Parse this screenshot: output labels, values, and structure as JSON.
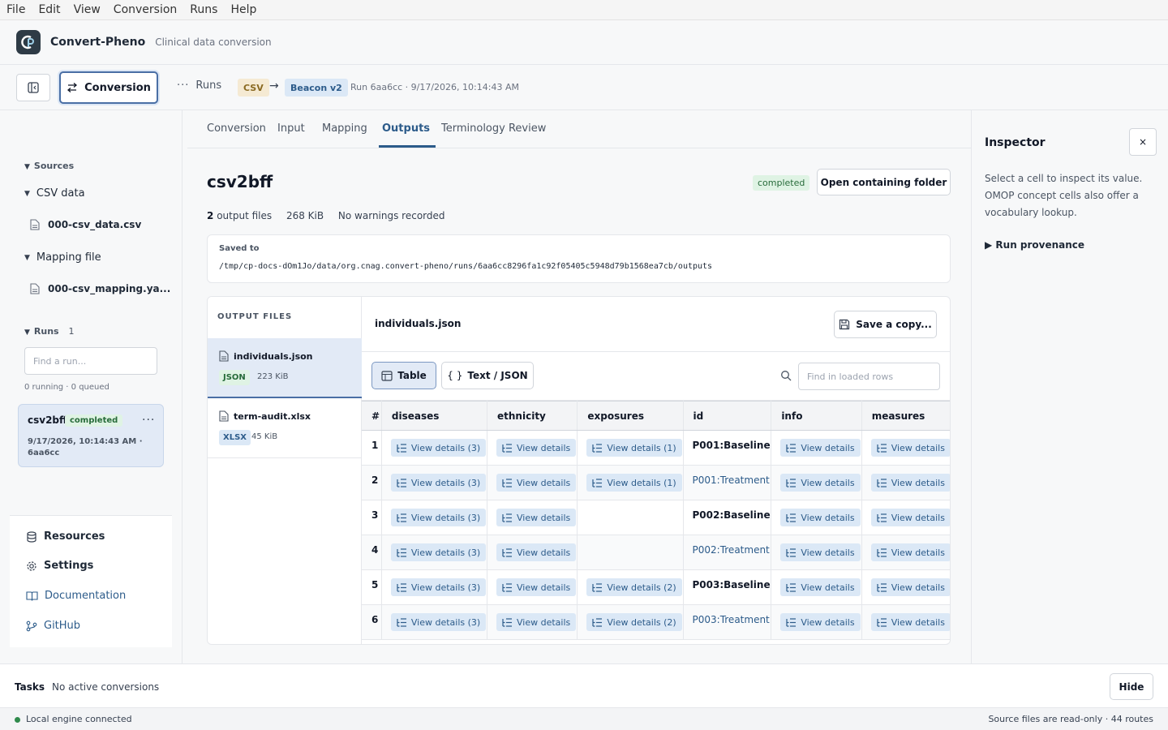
{
  "menu": [
    "File",
    "Edit",
    "View",
    "Conversion",
    "Runs",
    "Help"
  ],
  "app": {
    "name": "Convert-Pheno",
    "subtitle": "Clinical data conversion"
  },
  "toolbar": {
    "conversion_label": "Conversion",
    "runs_label": "Runs",
    "from_format": "CSV",
    "arrow": "→",
    "to_format": "Beacon v2",
    "run_info": "Run 6aa6cc · 9/17/2026, 10:14:43 AM"
  },
  "sidebar": {
    "sources_label": "Sources",
    "csv_group": "CSV data",
    "csv_file": "000-csv_data.csv",
    "mapping_group": "Mapping file",
    "mapping_file": "000-csv_mapping.ya...",
    "runs_label": "Runs",
    "runs_count": "1",
    "run_search_placeholder": "Find a run...",
    "run_status_counts": "0 running · 0 queued",
    "run_card": {
      "name": "csv2bff",
      "status": "completed",
      "more": "···",
      "date": "9/17/2026, 10:14:43 AM · 6aa6cc"
    },
    "nav": {
      "resources": "Resources",
      "settings": "Settings",
      "documentation": "Documentation",
      "github": "GitHub"
    }
  },
  "tabs": [
    "Conversion",
    "Input",
    "Mapping",
    "Outputs",
    "Terminology Review"
  ],
  "active_tab": "Outputs",
  "output": {
    "title": "csv2bff",
    "status": "completed",
    "open_folder": "Open containing folder",
    "file_count": "2",
    "file_count_label": "output files",
    "total_size": "268 KiB",
    "warnings": "No warnings recorded",
    "saved_to_label": "Saved to",
    "saved_path": "/tmp/cp-docs-dOm1Jo/data/org.cnag.convert-pheno/runs/6aa6cc8296fa1c92f05405c5948d79b1568ea7cb/outputs"
  },
  "files_panel": {
    "header": "OUTPUT FILES",
    "files": [
      {
        "name": "individuals.json",
        "type": "JSON",
        "size": "223 KiB"
      },
      {
        "name": "term-audit.xlsx",
        "type": "XLSX",
        "size": "45 KiB"
      }
    ]
  },
  "viewer": {
    "file_title": "individuals.json",
    "save_copy": "Save a copy...",
    "mode_table": "Table",
    "mode_text": "Text / JSON",
    "find_placeholder": "Find in loaded rows",
    "columns": [
      "#",
      "diseases",
      "ethnicity",
      "exposures",
      "id",
      "info",
      "measures"
    ],
    "rows": [
      {
        "num": "1",
        "diseases": "View details (3)",
        "ethnicity": "View details",
        "exposures": "View details (1)",
        "id": "P001:Baseline",
        "info": "View details",
        "measures": "View details"
      },
      {
        "num": "2",
        "diseases": "View details (3)",
        "ethnicity": "View details",
        "exposures": "View details (1)",
        "id": "P001:Treatment",
        "info": "View details",
        "measures": "View details"
      },
      {
        "num": "3",
        "diseases": "View details (3)",
        "ethnicity": "View details",
        "exposures": "",
        "id": "P002:Baseline",
        "info": "View details",
        "measures": "View details"
      },
      {
        "num": "4",
        "diseases": "View details (3)",
        "ethnicity": "View details",
        "exposures": "",
        "id": "P002:Treatment",
        "info": "View details",
        "measures": "View details"
      },
      {
        "num": "5",
        "diseases": "View details (3)",
        "ethnicity": "View details",
        "exposures": "View details (2)",
        "id": "P003:Baseline",
        "info": "View details",
        "measures": "View details"
      },
      {
        "num": "6",
        "diseases": "View details (3)",
        "ethnicity": "View details",
        "exposures": "View details (2)",
        "id": "P003:Treatment",
        "info": "View details",
        "measures": "View details"
      }
    ]
  },
  "inspector": {
    "title": "Inspector",
    "close": "×",
    "description": "Select a cell to inspect its value. OMOP concept cells also offer a vocabulary lookup.",
    "provenance": "▶ Run provenance"
  },
  "tasks": {
    "label": "Tasks",
    "value": "No active conversions",
    "hide": "Hide"
  },
  "statusbar": {
    "left": "Local engine connected",
    "right": "Source files are read-only · 44 routes"
  }
}
